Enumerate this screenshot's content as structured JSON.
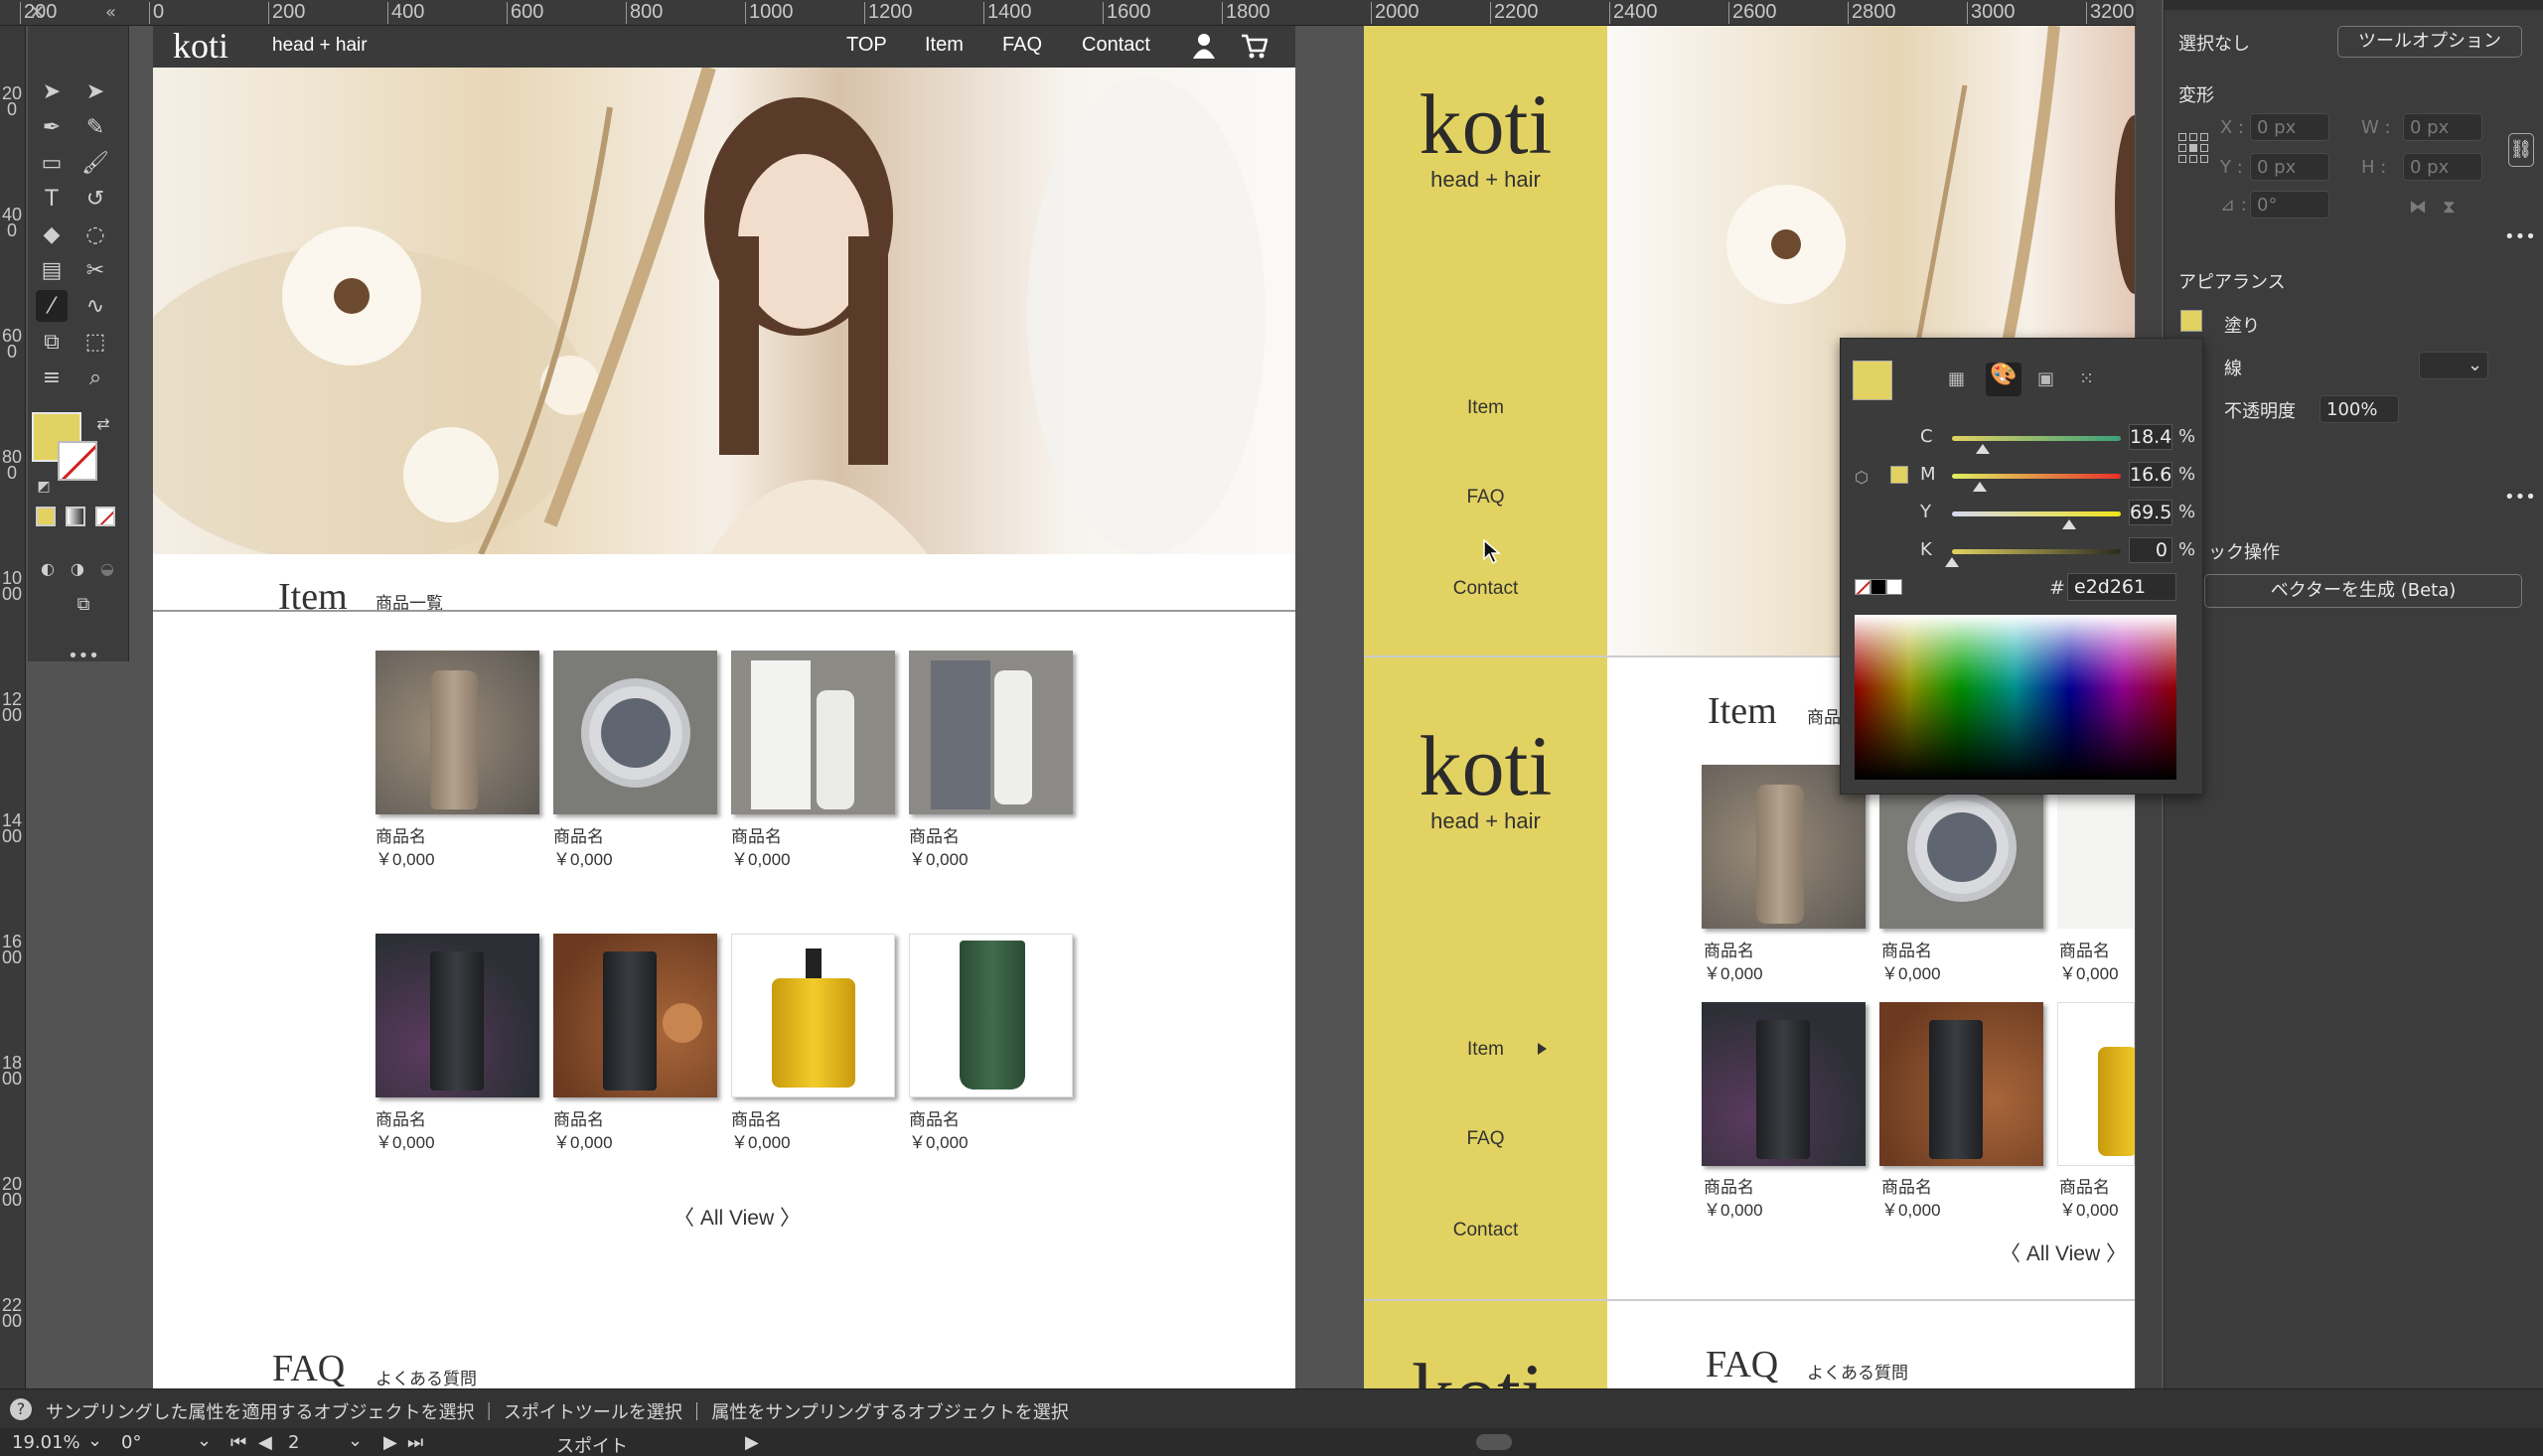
{
  "ruler": {
    "top_ticks": [
      "200",
      "0",
      "200",
      "400",
      "600",
      "800",
      "1000",
      "1200",
      "1400",
      "1600",
      "1800",
      "2000",
      "2200",
      "2400",
      "2600",
      "2800",
      "3000",
      "3200"
    ],
    "left_ticks": [
      "200",
      "400",
      "600",
      "800",
      "1000",
      "1200",
      "1400",
      "1600",
      "1800",
      "2000",
      "2200"
    ]
  },
  "tools": {
    "fill_color": "#e2d261"
  },
  "artboard1": {
    "logo": "koti",
    "tagline": "head + hair",
    "nav": [
      "TOP",
      "Item",
      "FAQ",
      "Contact"
    ],
    "item_title": "Item",
    "item_sub": "商品一覧",
    "products_row1": [
      {
        "name": "商品名",
        "price": "￥0,000",
        "theme": "bottle-beige"
      },
      {
        "name": "商品名",
        "price": "￥0,000",
        "theme": "jar-dark"
      },
      {
        "name": "商品名",
        "price": "￥0,000",
        "theme": "tube-white"
      },
      {
        "name": "商品名",
        "price": "￥0,000",
        "theme": "tube-grey"
      }
    ],
    "products_row2": [
      {
        "name": "商品名",
        "price": "￥0,000",
        "theme": "tube-black-purple"
      },
      {
        "name": "商品名",
        "price": "￥0,000",
        "theme": "tube-black-orange"
      },
      {
        "name": "商品名",
        "price": "￥0,000",
        "theme": "bottle-yellow"
      },
      {
        "name": "商品名",
        "price": "￥0,000",
        "theme": "tube-green"
      }
    ],
    "all_view": "〈 All View 〉",
    "faq_title": "FAQ",
    "faq_sub": "よくある質問"
  },
  "artboard2": {
    "logo": "koti",
    "tagline": "head + hair",
    "nav_top": [
      "Item",
      "FAQ",
      "Contact"
    ],
    "nav_bottom": [
      "Item",
      "FAQ",
      "Contact"
    ],
    "item_title": "Item",
    "item_sub": "商品",
    "products_row1": [
      {
        "name": "商品名",
        "price": "￥0,000"
      },
      {
        "name": "商品名",
        "price": "￥0,000"
      },
      {
        "name": "商品名",
        "price": "￥0,000"
      }
    ],
    "products_row2": [
      {
        "name": "商品名",
        "price": "￥0,000"
      },
      {
        "name": "商品名",
        "price": "￥0,000"
      },
      {
        "name": "商品名",
        "price": "￥0,000"
      }
    ],
    "all_view": "〈 All View 〉",
    "faq_title": "FAQ",
    "faq_sub": "よくある質問"
  },
  "panel": {
    "selection": "選択なし",
    "tool_options": "ツールオプション",
    "transform_title": "変形",
    "x_label": "X :",
    "y_label": "Y :",
    "w_label": "W :",
    "h_label": "H :",
    "x_val": "0 px",
    "y_val": "0 px",
    "w_val": "0 px",
    "h_val": "0 px",
    "angle_label": "⊿ :",
    "angle_val": "0°",
    "appearance_title": "アピアランス",
    "fill_label": "塗り",
    "stroke_label": "線",
    "opacity_label": "不透明度",
    "opacity_val": "100%",
    "quick_actions": "ック操作",
    "vector_button": "ベクターを生成 (Beta)"
  },
  "picker": {
    "swatch": "#e2d261",
    "c_label": "C",
    "m_label": "M",
    "y_label": "Y",
    "k_label": "K",
    "c_val": "18.4",
    "m_val": "16.6",
    "y_val": "69.5",
    "k_val": "0",
    "c_pos": 0.184,
    "m_pos": 0.166,
    "y_pos": 0.695,
    "k_pos": 0,
    "pct": "%",
    "hash": "#",
    "hex": "e2d261"
  },
  "status": {
    "message": "サンプリングした属性を適用するオブジェクトを選択 ｜ スポイトツールを選択 ｜ 属性をサンプリングするオブジェクトを選択",
    "zoom": "19.01%",
    "rotate": "0°",
    "artboard_num": "2",
    "tool_name": "スポイト"
  }
}
